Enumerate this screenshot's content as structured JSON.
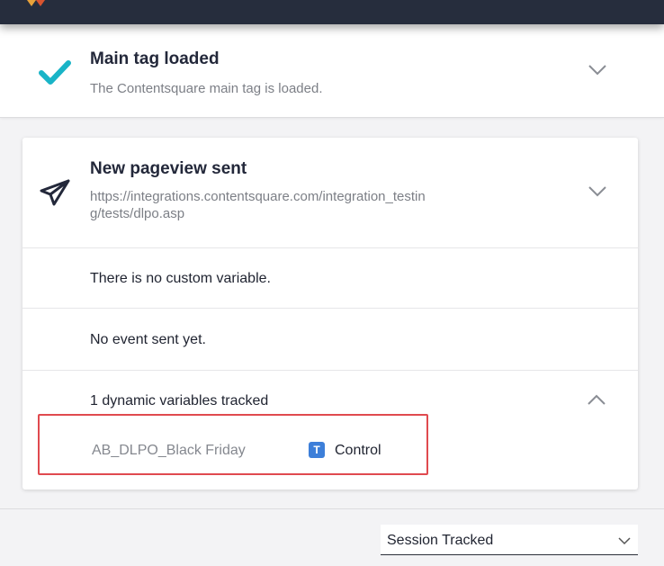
{
  "main_tag": {
    "title": "Main tag loaded",
    "subtitle": "The Contentsquare main tag is loaded.",
    "status_color": "#19b4c7",
    "icon": "check-icon",
    "expand_icon": "chevron-down-icon"
  },
  "pageview": {
    "title": "New pageview sent",
    "url_line1": "https://integrations.contentsquare.com/integration_testin",
    "url_line2": "g/tests/dlpo.asp",
    "icon": "paper-plane-icon",
    "expand_icon": "chevron-down-icon",
    "custom_variables_text": "There is no custom variable.",
    "events_text": "No event sent yet.",
    "dynamic_variables": {
      "header": "1 dynamic variables tracked",
      "collapse_icon": "chevron-up-icon",
      "items": [
        {
          "name": "AB_DLPO_Black Friday",
          "type_badge": "T",
          "value": "Control"
        }
      ]
    }
  },
  "session_select": {
    "value": "Session Tracked",
    "icon": "chevron-down-icon"
  },
  "colors": {
    "topbar": "#262d3d",
    "accent_check": "#19b4c7",
    "highlight_border": "#e04a4f",
    "badge": "#3d7fd9"
  }
}
